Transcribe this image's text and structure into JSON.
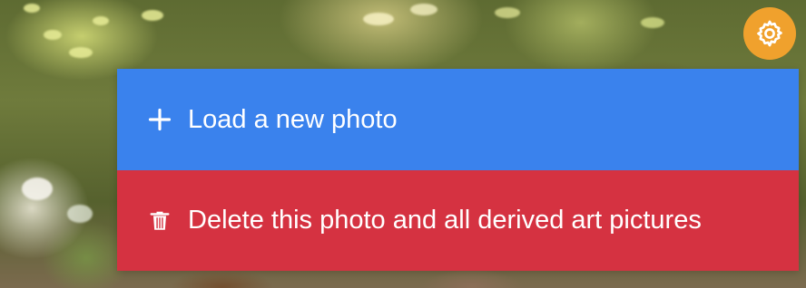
{
  "background": {
    "description": "",
    "type": "photo"
  },
  "settings": {
    "icon": "gear-icon",
    "color": "#f0a12d"
  },
  "menu": {
    "items": [
      {
        "label": "Load a new photo",
        "icon": "plus-icon",
        "color": "#3a82ed"
      },
      {
        "label": "Delete this photo and all derived art pictures",
        "icon": "trash-icon",
        "color": "#d53241"
      }
    ]
  }
}
